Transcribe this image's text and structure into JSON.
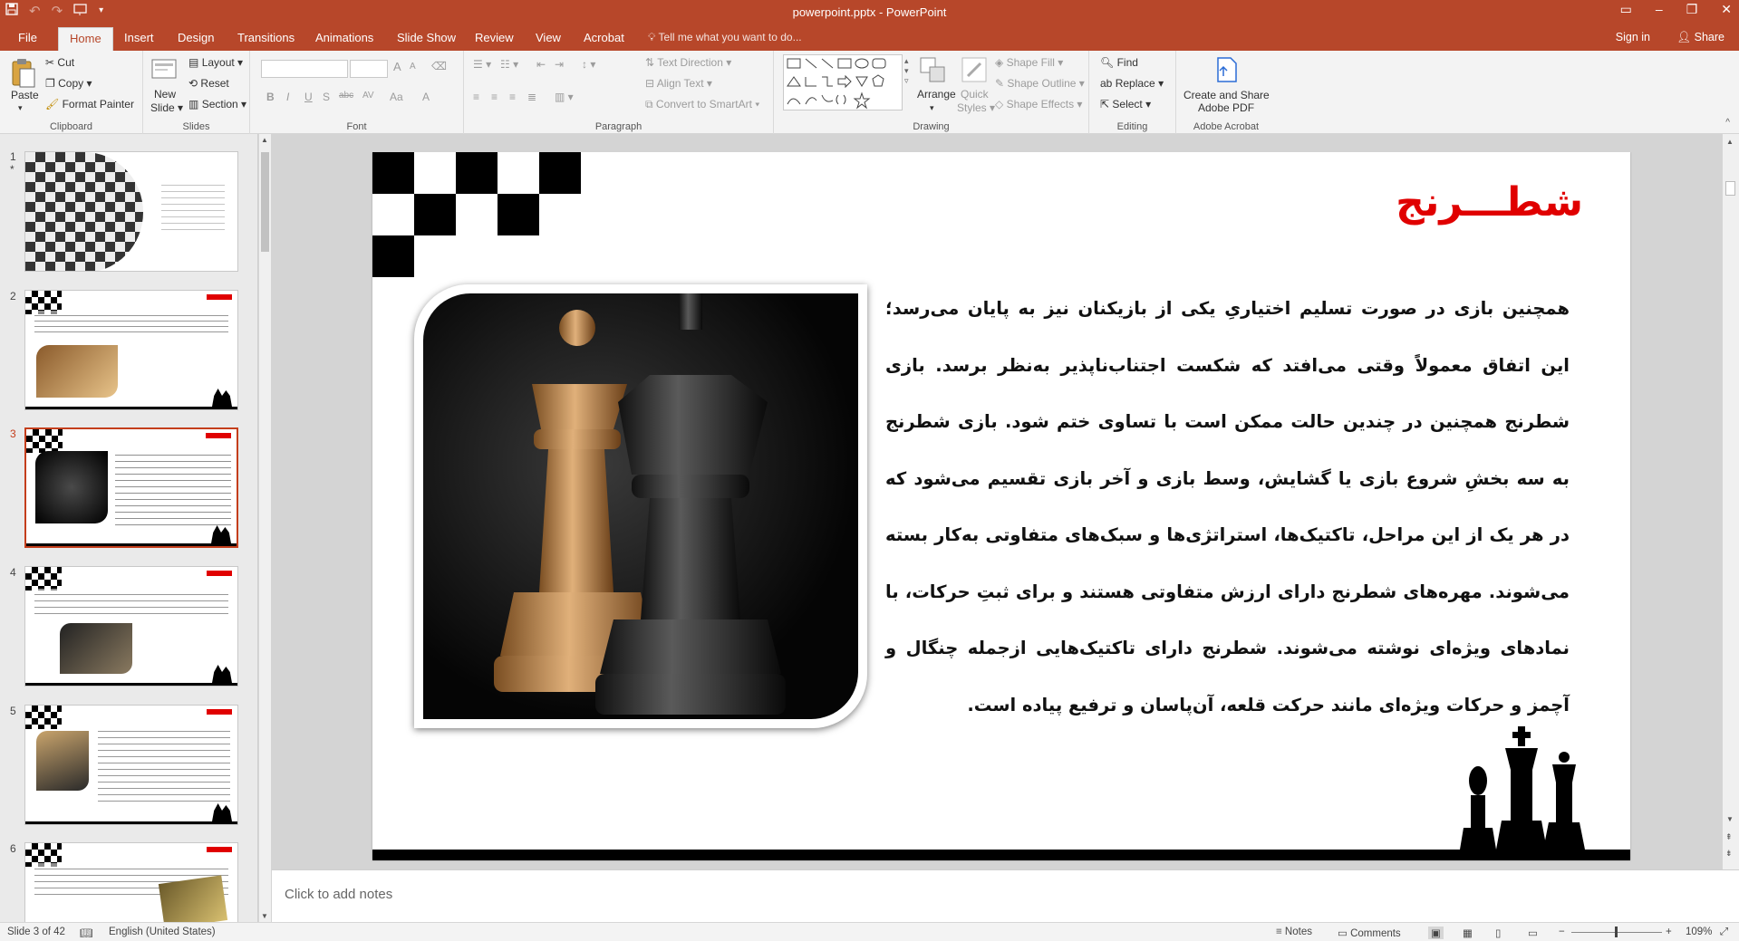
{
  "window": {
    "title": "powerpoint.pptx - PowerPoint",
    "minimize": "–",
    "restore": "❐",
    "close": "✕",
    "ribbon_options": "▭"
  },
  "tabs": [
    "File",
    "Home",
    "Insert",
    "Design",
    "Transitions",
    "Animations",
    "Slide Show",
    "Review",
    "View",
    "Acrobat"
  ],
  "tell_me": "Tell me what you want to do...",
  "sign_in": "Sign in",
  "share": "Share",
  "ribbon": {
    "clipboard": {
      "label": "Clipboard",
      "paste": "Paste",
      "cut": "Cut",
      "copy": "Copy",
      "format_painter": "Format Painter"
    },
    "slides": {
      "label": "Slides",
      "new_slide_1": "New",
      "new_slide_2": "Slide",
      "layout": "Layout",
      "reset": "Reset",
      "section": "Section"
    },
    "font": {
      "label": "Font",
      "bold": "B",
      "italic": "I",
      "underline": "U",
      "strike": "S",
      "shadow": "abc",
      "spacing": "AV",
      "case": "Aa",
      "color": "A",
      "grow": "A",
      "shrink": "A"
    },
    "paragraph": {
      "label": "Paragraph",
      "text_direction": "Text Direction",
      "align_text": "Align Text",
      "smartart": "Convert to SmartArt"
    },
    "drawing": {
      "label": "Drawing",
      "arrange": "Arrange",
      "quick_styles_1": "Quick",
      "quick_styles_2": "Styles",
      "shape_fill": "Shape Fill",
      "shape_outline": "Shape Outline",
      "shape_effects": "Shape Effects"
    },
    "editing": {
      "label": "Editing",
      "find": "Find",
      "replace": "Replace",
      "select": "Select"
    },
    "acrobat": {
      "label": "Adobe Acrobat",
      "create_1": "Create and Share",
      "create_2": "Adobe PDF"
    }
  },
  "thumbnails": [
    {
      "num": "1",
      "star": "*"
    },
    {
      "num": "2"
    },
    {
      "num": "3"
    },
    {
      "num": "4"
    },
    {
      "num": "5"
    },
    {
      "num": "6"
    }
  ],
  "slide": {
    "title": "شطـــرنج",
    "body": "همچنین بازی در صورت تسلیم اختیاریِ یکی از بازیکنان نیز به پایان می‌رسد؛ این اتفاق معمولاً وقتی می‌افتد که شکست اجتناب‌ناپذیر به‌نظر برسد. بازی شطرنج همچنین در چندین حالت ممکن است با تساوی ختم شود. بازی شطرنج به سه بخشِ شروع بازی یا گشایش، وسط بازی و آخر بازی تقسیم می‌شود که در هر یک از این مراحل، تاکتیک‌ها، استراتژی‌ها و سبک‌های متفاوتی به‌کار بسته می‌شوند. مهره‌های شطرنج دارای ارزش متفاوتی هستند و برای ثبتِ حرکات، با نمادهای ویژه‌ای نوشته می‌شوند. شطرنج دارای تاکتیک‌هایی ازجمله چنگال و آچمز و حرکات ویژه‌ای مانند حرکت قلعه، آن‌پاسان و ترفیع پیاده است."
  },
  "notes_placeholder": "Click to add notes",
  "status": {
    "slide_of": "Slide 3 of 42",
    "language": "English (United States)",
    "notes": "Notes",
    "comments": "Comments",
    "zoom_minus": "−",
    "zoom_plus": "+",
    "zoom": "109%"
  },
  "colors": {
    "accent": "#b7472a",
    "title_red": "#e00000",
    "selection": "#c43e1c"
  }
}
